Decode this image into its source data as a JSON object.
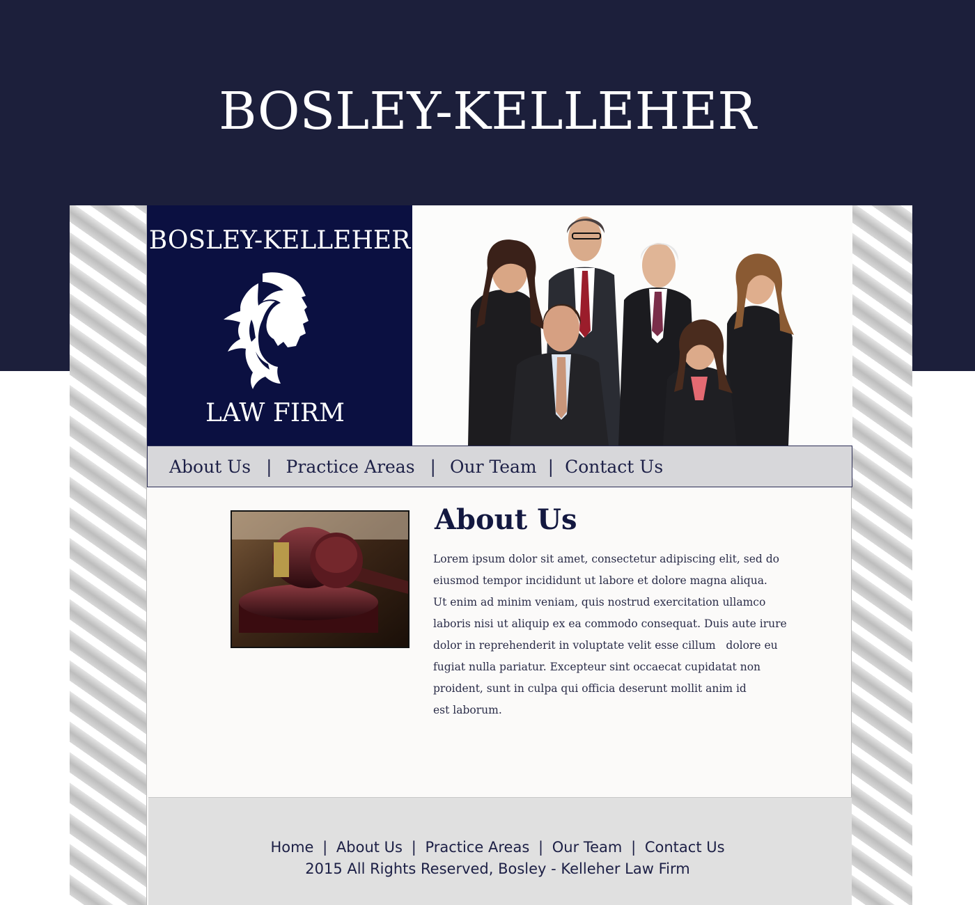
{
  "page": {
    "title": "BOSLEY-KELLEHER"
  },
  "logo": {
    "title": "BOSLEY-KELLEHER",
    "subtitle": "LAW FIRM",
    "icon": "lion-head-icon",
    "background": "#0b1041"
  },
  "nav": {
    "items": [
      {
        "label": "About Us"
      },
      {
        "label": "Practice Areas"
      },
      {
        "label": "Our Team"
      },
      {
        "label": "Contact Us"
      }
    ],
    "separator": "|"
  },
  "about": {
    "heading": "About Us",
    "lines": [
      "Lorem ipsum dolor sit amet, consectetur adipiscing elit, sed do",
      "eiusmod tempor incididunt ut labore et dolore magna aliqua.",
      "Ut enim ad minim veniam, quis nostrud exercitation ullamco",
      "laboris nisi ut aliquip ex ea commodo consequat. Duis aute irure",
      "dolor in reprehenderit in voluptate velit esse cillum   dolore eu",
      "fugiat nulla pariatur. Excepteur sint occaecat cupidatat non",
      "proident, sunt in culpa qui officia deserunt mollit anim id",
      "est laborum."
    ]
  },
  "footer": {
    "links": [
      {
        "label": "Home"
      },
      {
        "label": "About Us"
      },
      {
        "label": "Practice Areas"
      },
      {
        "label": "Our Team"
      },
      {
        "label": "Contact Us"
      }
    ],
    "separator": "|",
    "copyright": "2015 All Rights Reserved, Bosley - Kelleher Law Firm"
  },
  "colors": {
    "header_band": "#1c1f3b",
    "logo_panel": "#0b1041",
    "navbar": "#d7d7da",
    "footer": "#e0e0e0",
    "text_dark": "#131840"
  }
}
